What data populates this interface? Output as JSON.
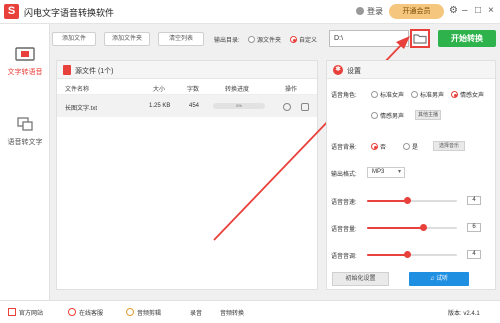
{
  "app": {
    "title": "闪电文字语音转换软件",
    "logo_char": "S",
    "accent": "#e8403b"
  },
  "header": {
    "login": "登录",
    "vip": "开通会员",
    "controls": [
      "⚙",
      "–",
      "□",
      "×"
    ]
  },
  "sidebar": {
    "items": [
      {
        "label": "文字转语音",
        "active": true,
        "icon": "text-to-speech-icon"
      },
      {
        "label": "语音转文字",
        "active": false,
        "icon": "speech-to-text-icon"
      }
    ]
  },
  "toolbar": {
    "add_file": "添加文件",
    "add_folder": "添加文件夹",
    "clear_list": "清空列表",
    "output_label": "输出目录:",
    "option_source": "源文件夹",
    "option_custom": "自定义",
    "path_value": "D:\\",
    "start": "开始转换"
  },
  "file_panel": {
    "title": "源文件 (1个)",
    "columns": [
      "文件名称",
      "大小",
      "字数",
      "转换进度",
      "操作"
    ],
    "rows": [
      {
        "name": "长图文字.txt",
        "size": "1.25 KB",
        "words": "454",
        "progress": "0%",
        "progress_value": 0
      }
    ]
  },
  "settings": {
    "title": "设置",
    "voice_type_label": "语音角色:",
    "voice_types": [
      {
        "label": "标准女声",
        "selected": false
      },
      {
        "label": "标准男声",
        "selected": false
      },
      {
        "label": "情感女声",
        "selected": true
      },
      {
        "label": "情感男声",
        "selected": false
      }
    ],
    "other_voice_btn": "其他主播",
    "bg_label": "语音背景:",
    "bg_no": "否",
    "bg_yes": "是",
    "bg_btn": "选择音乐",
    "format_label": "输出格式:",
    "format_value": "MP3",
    "speed_label": "语音音速:",
    "speed_value": "4",
    "speed_fraction": 0.44,
    "volume_label": "语音音量:",
    "volume_value": "6",
    "volume_fraction": 0.62,
    "pitch_label": "语音音调:",
    "pitch_value": "4",
    "pitch_fraction": 0.44,
    "init_btn": "初始化设置",
    "listen_btn": "试听"
  },
  "footer": {
    "website": "官方网站",
    "support": "在线客服",
    "audio_cut": "音频剪辑",
    "record": "录音",
    "audio_convert": "音频转换",
    "version": "版本: v2.4.1"
  }
}
